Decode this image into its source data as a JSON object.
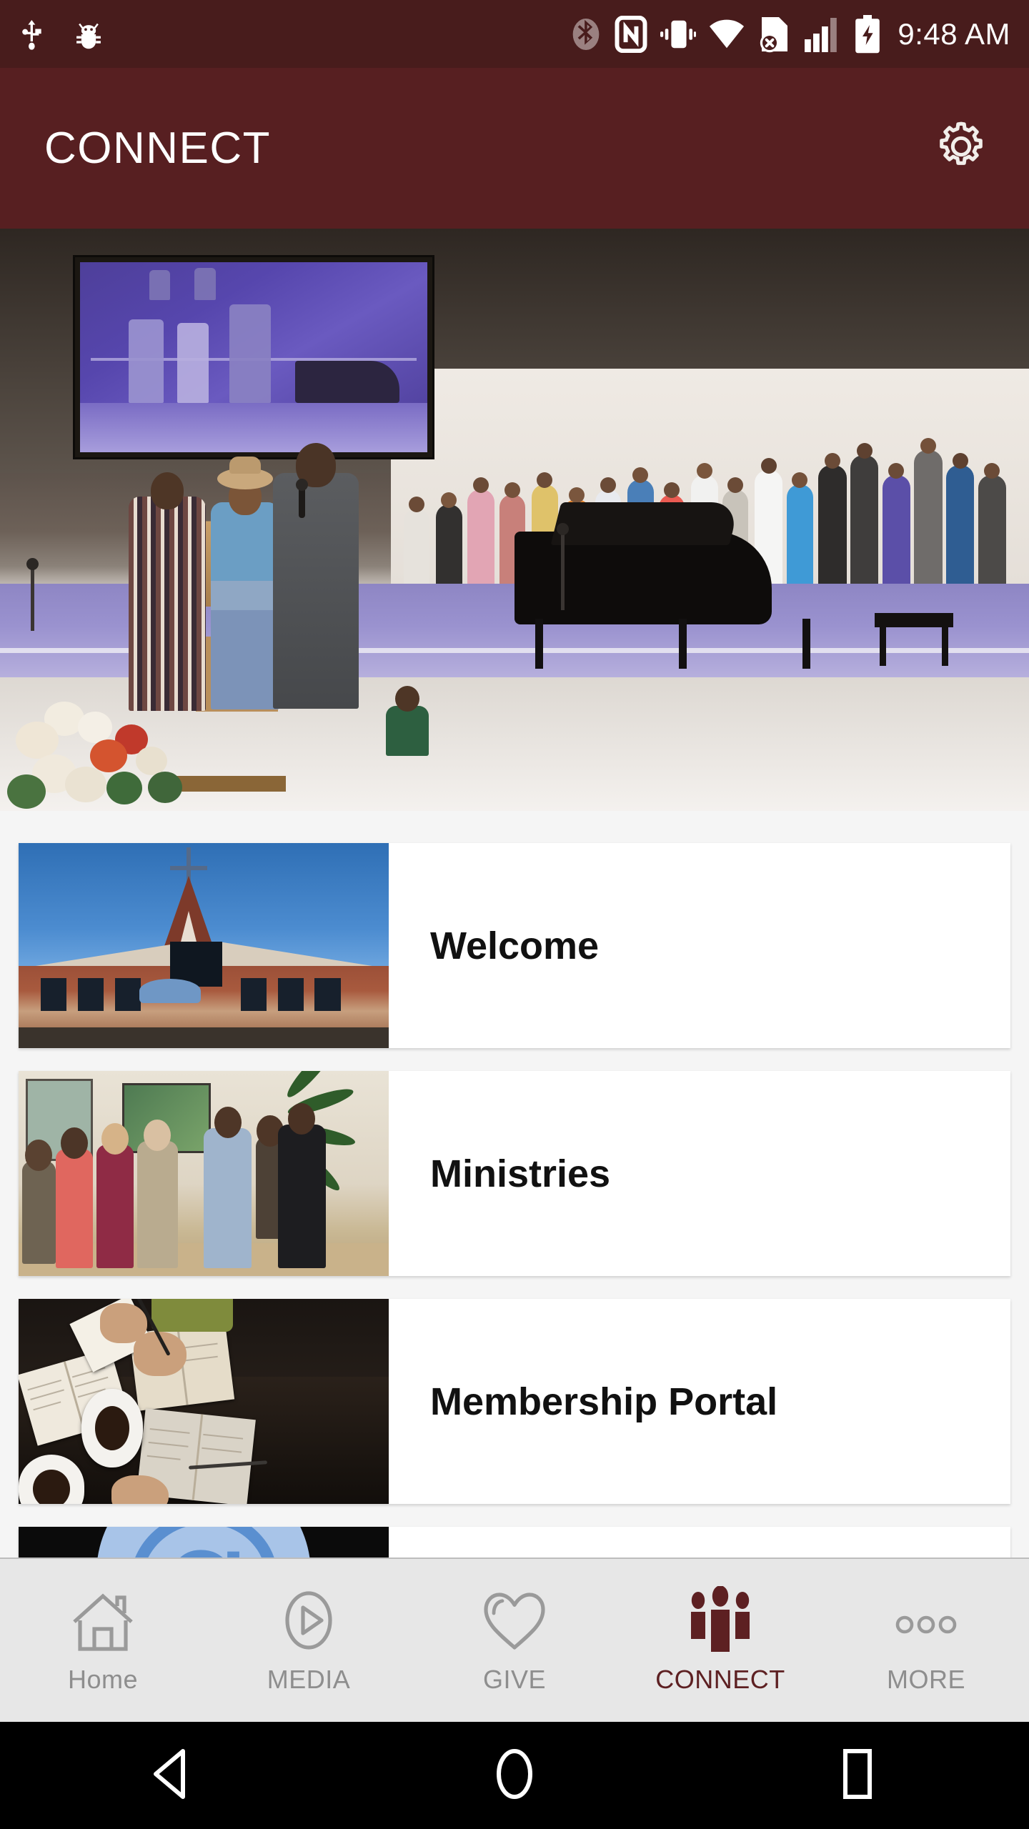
{
  "status_bar": {
    "time": "9:48 AM",
    "background_color": "#481c1c",
    "left_icons": [
      {
        "name": "usb-icon",
        "label": "USB connected"
      },
      {
        "name": "bug-icon",
        "label": "USB debugging"
      }
    ],
    "right_icons": [
      {
        "name": "bluetooth-icon",
        "label": "Bluetooth"
      },
      {
        "name": "nfc-icon",
        "label": "NFC"
      },
      {
        "name": "vibrate-icon",
        "label": "Vibrate"
      },
      {
        "name": "wifi-icon",
        "label": "Wi-Fi"
      },
      {
        "name": "sim-error-icon",
        "label": "No SIM card"
      },
      {
        "name": "signal-icon",
        "label": "Cellular signal"
      },
      {
        "name": "battery-charging-icon",
        "label": "Battery charging"
      }
    ]
  },
  "app_bar": {
    "title": "CONNECT",
    "background_color": "#571f21",
    "settings_label": "Settings"
  },
  "hero": {
    "name": "church-service-photo",
    "alt": "Church service with speakers at podium, choir and grand piano on stage"
  },
  "list": {
    "items": [
      {
        "label": "Welcome",
        "thumb": "church-exterior-photo",
        "thumb_alt": "Church building exterior at dusk with spire and cross"
      },
      {
        "label": "Ministries",
        "thumb": "congregation-lobby-photo",
        "thumb_alt": "People greeting each other in church lobby"
      },
      {
        "label": "Membership Portal",
        "thumb": "bible-study-photo",
        "thumb_alt": "Open bibles, notebooks and coffee cups on a table"
      },
      {
        "label": "",
        "thumb": "email-at-symbol",
        "thumb_alt": "Blue at-symbol email icon",
        "partial": true
      }
    ]
  },
  "tab_bar": {
    "background_color": "#e7e7e7",
    "active_color": "#5d2022",
    "inactive_color": "#8e8e8e",
    "tabs": [
      {
        "label": "Home",
        "icon": "home-icon",
        "active": false
      },
      {
        "label": "MEDIA",
        "icon": "play-circle-icon",
        "active": false
      },
      {
        "label": "GIVE",
        "icon": "heart-icon",
        "active": false
      },
      {
        "label": "CONNECT",
        "icon": "people-group-icon",
        "active": true
      },
      {
        "label": "MORE",
        "icon": "more-dots-icon",
        "active": false
      }
    ]
  },
  "android_nav": {
    "buttons": [
      {
        "name": "back-button",
        "label": "Back"
      },
      {
        "name": "home-button",
        "label": "Home"
      },
      {
        "name": "recents-button",
        "label": "Recent apps"
      }
    ]
  }
}
